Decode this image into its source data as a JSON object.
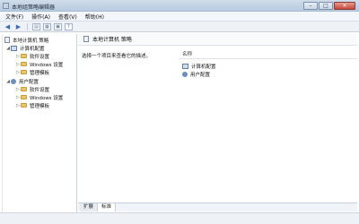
{
  "window": {
    "title": "本地组策略编辑器",
    "controls": {
      "minimize": "–",
      "maximize": "□",
      "close": "✕"
    }
  },
  "menu": {
    "items": [
      {
        "label": "文件(F)"
      },
      {
        "label": "操作(A)"
      },
      {
        "label": "查看(V)"
      },
      {
        "label": "帮助(H)"
      }
    ]
  },
  "toolbar": {
    "icons": [
      "back-arrow-icon",
      "forward-arrow-icon",
      "show-hide-tree-icon",
      "properties-icon",
      "export-list-icon",
      "help-icon"
    ]
  },
  "tree": {
    "root": {
      "label": "本地计算机 策略"
    },
    "computer": {
      "label": "计算机配置",
      "children": [
        {
          "label": "软件设置"
        },
        {
          "label": "Windows 设置"
        },
        {
          "label": "管理模板"
        }
      ]
    },
    "user": {
      "label": "用户配置",
      "children": [
        {
          "label": "软件设置"
        },
        {
          "label": "Windows 设置"
        },
        {
          "label": "管理模板"
        }
      ]
    }
  },
  "main": {
    "header_title": "本地计算机 策略",
    "description": "选择一个项目来查看它的描述。",
    "column_name": "名称",
    "rows": [
      {
        "label": "计算机配置"
      },
      {
        "label": "用户配置"
      }
    ]
  },
  "tabs": [
    {
      "label": "扩展",
      "active": false
    },
    {
      "label": "标准",
      "active": true
    }
  ]
}
